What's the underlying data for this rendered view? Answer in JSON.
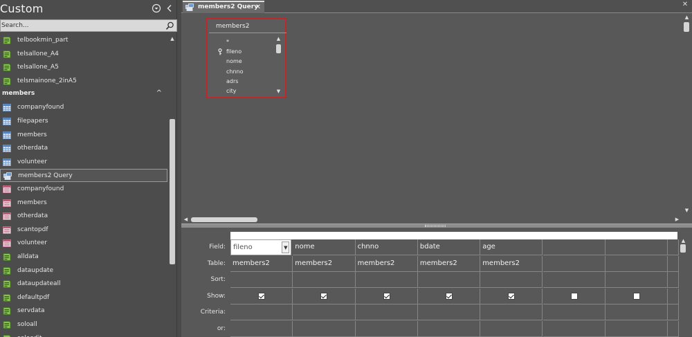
{
  "nav": {
    "title": "Custom",
    "search_placeholder": "Search...",
    "items_top": [
      {
        "label": "telbookmin_part",
        "icon": "report-icon"
      },
      {
        "label": "telsallone_A4",
        "icon": "report-icon"
      },
      {
        "label": "telsallone_A5",
        "icon": "report-icon"
      },
      {
        "label": "telsmainone_2inA5",
        "icon": "report-icon"
      }
    ],
    "group": {
      "label": "members",
      "chevron": "^"
    },
    "items_group": [
      {
        "label": "companyfound",
        "icon": "table-icon"
      },
      {
        "label": "filepapers",
        "icon": "table-icon"
      },
      {
        "label": "members",
        "icon": "table-icon"
      },
      {
        "label": "otherdata",
        "icon": "table-icon"
      },
      {
        "label": "volunteer",
        "icon": "table-icon"
      },
      {
        "label": "members2 Query",
        "icon": "query-icon",
        "selected": true
      },
      {
        "label": "companyfound",
        "icon": "form-icon"
      },
      {
        "label": "members",
        "icon": "form-icon"
      },
      {
        "label": "otherdata",
        "icon": "form-icon"
      },
      {
        "label": "scantopdf",
        "icon": "form-icon"
      },
      {
        "label": "volunteer",
        "icon": "form-icon"
      },
      {
        "label": "alldata",
        "icon": "report-icon"
      },
      {
        "label": "dataupdate",
        "icon": "report-icon"
      },
      {
        "label": "dataupdateall",
        "icon": "report-icon"
      },
      {
        "label": "defaultpdf",
        "icon": "report-icon"
      },
      {
        "label": "servdata",
        "icon": "report-icon"
      },
      {
        "label": "soloall",
        "icon": "report-icon"
      },
      {
        "label": "soloedit",
        "icon": "report-icon"
      }
    ]
  },
  "tab": {
    "label": "members2 Query",
    "close": "✕"
  },
  "doc_close": "✕",
  "field_list": {
    "title": "members2",
    "fields": [
      "*",
      "fileno",
      "nome",
      "chnno",
      "adrs",
      "city"
    ],
    "key_field": "fileno"
  },
  "grid": {
    "row_labels": [
      "Field:",
      "Table:",
      "Sort:",
      "Show:",
      "Criteria:",
      "or:"
    ],
    "columns": [
      {
        "field": "fileno",
        "table": "members2",
        "show": true
      },
      {
        "field": "nome",
        "table": "members2",
        "show": true
      },
      {
        "field": "chnno",
        "table": "members2",
        "show": true
      },
      {
        "field": "bdate",
        "table": "members2",
        "show": true
      },
      {
        "field": "age",
        "table": "members2",
        "show": true
      },
      {
        "field": "",
        "table": "",
        "show": false
      },
      {
        "field": "",
        "table": "",
        "show": false
      },
      {
        "field": "",
        "table": "",
        "show": false
      }
    ]
  },
  "colors": {
    "accent_red": "#c0272d",
    "pane_bg": "#565656",
    "nav_bg": "#4c4c4c"
  }
}
